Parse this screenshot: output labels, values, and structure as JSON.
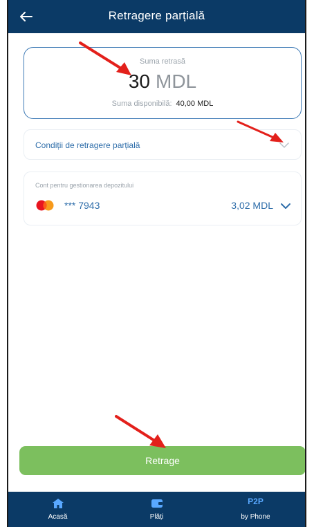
{
  "header": {
    "title": "Retragere parțială",
    "back_icon": "arrow-left-icon"
  },
  "amount_card": {
    "label": "Suma retrasă",
    "amount": "30",
    "currency": "MDL",
    "available_label": "Suma disponibilă:",
    "available_value": "40,00 MDL"
  },
  "conditions": {
    "label": "Condiții de retragere parțială",
    "icon": "chevron-down-icon"
  },
  "account": {
    "label": "Cont pentru gestionarea depozitului",
    "card_icon": "mastercard-icon",
    "masked_number": "*** 7943",
    "balance": "3,02 MDL",
    "icon": "chevron-down-icon"
  },
  "actions": {
    "submit_label": "Retrage"
  },
  "tabbar": {
    "items": [
      {
        "label": "Acasă",
        "icon": "home-icon"
      },
      {
        "label": "Plăți",
        "icon": "wallet-icon"
      },
      {
        "label": "by Phone",
        "icon_text": "P2P"
      }
    ]
  },
  "colors": {
    "header_bg": "#0b3a66",
    "accent_blue": "#2f6eaa",
    "button_green": "#7cbf5e",
    "annotation_red": "#e3201b"
  }
}
